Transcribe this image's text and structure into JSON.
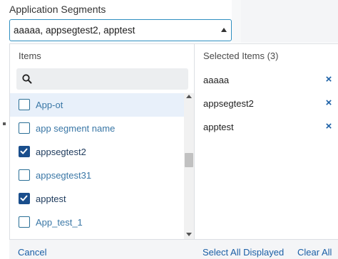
{
  "field": {
    "label": "Application Segments",
    "selected_display": "aaaaa, appsegtest2, apptest"
  },
  "dropdown": {
    "items_header": "Items",
    "search": {
      "placeholder": "",
      "value": ""
    },
    "items": [
      {
        "label": "App-ot",
        "checked": false,
        "highlighted": true
      },
      {
        "label": "app segment name",
        "checked": false,
        "highlighted": false
      },
      {
        "label": "appsegtest2",
        "checked": true,
        "highlighted": false
      },
      {
        "label": "appsegtest31",
        "checked": false,
        "highlighted": false
      },
      {
        "label": "apptest",
        "checked": true,
        "highlighted": false
      },
      {
        "label": "App_test_1",
        "checked": false,
        "highlighted": false
      }
    ],
    "selected_header": "Selected Items (3)",
    "selected": [
      {
        "label": "aaaaa"
      },
      {
        "label": "appsegtest2"
      },
      {
        "label": "apptest"
      }
    ],
    "scroll_position": 0.45
  },
  "footer": {
    "cancel_label": "Cancel",
    "select_all_label": "Select All Displayed",
    "clear_all_label": "Clear All"
  },
  "colors": {
    "accent": "#1a5fa6",
    "checkbox_checked": "#1a4e8c",
    "highlight": "#e8f0fa"
  },
  "icons": {
    "search": "search-icon",
    "caret": "caret-up-icon",
    "remove": "close-icon",
    "check": "check-icon"
  }
}
